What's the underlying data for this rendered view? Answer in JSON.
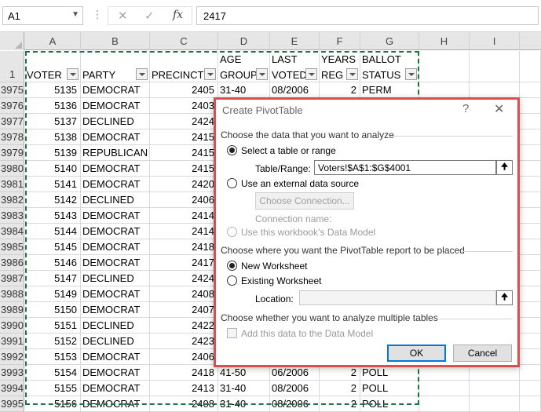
{
  "formula_bar": {
    "name_box": "A1",
    "formula": "2417"
  },
  "columns": [
    "A",
    "B",
    "C",
    "D",
    "E",
    "F",
    "G",
    "H",
    "I"
  ],
  "header_row": {
    "row_number": "1",
    "cells": [
      {
        "l1": "",
        "l2": "VOTER"
      },
      {
        "l1": "",
        "l2": "PARTY"
      },
      {
        "l1": "",
        "l2": "PRECINCT"
      },
      {
        "l1": "AGE",
        "l2": "GROUP"
      },
      {
        "l1": "LAST",
        "l2": "VOTED"
      },
      {
        "l1": "YEARS",
        "l2": "REG"
      },
      {
        "l1": "BALLOT",
        "l2": "STATUS"
      }
    ]
  },
  "rows": [
    {
      "n": "3975",
      "a": "5135",
      "b": "DEMOCRAT",
      "c": "2405",
      "d": "31-40",
      "e": "08/2006",
      "f": "2",
      "g": "PERM"
    },
    {
      "n": "3976",
      "a": "5136",
      "b": "DEMOCRAT",
      "c": "2403",
      "d": "",
      "e": "",
      "f": "",
      "g": ""
    },
    {
      "n": "3977",
      "a": "5137",
      "b": "DECLINED",
      "c": "2424",
      "d": "",
      "e": "",
      "f": "",
      "g": ""
    },
    {
      "n": "3978",
      "a": "5138",
      "b": "DEMOCRAT",
      "c": "2415",
      "d": "",
      "e": "",
      "f": "",
      "g": ""
    },
    {
      "n": "3979",
      "a": "5139",
      "b": "REPUBLICAN",
      "c": "2415",
      "d": "",
      "e": "",
      "f": "",
      "g": ""
    },
    {
      "n": "3980",
      "a": "5140",
      "b": "DEMOCRAT",
      "c": "2415",
      "d": "",
      "e": "",
      "f": "",
      "g": ""
    },
    {
      "n": "3981",
      "a": "5141",
      "b": "DEMOCRAT",
      "c": "2420",
      "d": "",
      "e": "",
      "f": "",
      "g": ""
    },
    {
      "n": "3982",
      "a": "5142",
      "b": "DECLINED",
      "c": "2406",
      "d": "",
      "e": "",
      "f": "",
      "g": ""
    },
    {
      "n": "3983",
      "a": "5143",
      "b": "DEMOCRAT",
      "c": "2414",
      "d": "",
      "e": "",
      "f": "",
      "g": ""
    },
    {
      "n": "3984",
      "a": "5144",
      "b": "DEMOCRAT",
      "c": "2414",
      "d": "",
      "e": "",
      "f": "",
      "g": ""
    },
    {
      "n": "3985",
      "a": "5145",
      "b": "DEMOCRAT",
      "c": "2418",
      "d": "",
      "e": "",
      "f": "",
      "g": ""
    },
    {
      "n": "3986",
      "a": "5146",
      "b": "DEMOCRAT",
      "c": "2417",
      "d": "",
      "e": "",
      "f": "",
      "g": ""
    },
    {
      "n": "3987",
      "a": "5147",
      "b": "DECLINED",
      "c": "2424",
      "d": "",
      "e": "",
      "f": "",
      "g": ""
    },
    {
      "n": "3988",
      "a": "5149",
      "b": "DEMOCRAT",
      "c": "2408",
      "d": "",
      "e": "",
      "f": "",
      "g": ""
    },
    {
      "n": "3989",
      "a": "5150",
      "b": "DEMOCRAT",
      "c": "2407",
      "d": "",
      "e": "",
      "f": "",
      "g": ""
    },
    {
      "n": "3990",
      "a": "5151",
      "b": "DECLINED",
      "c": "2422",
      "d": "",
      "e": "",
      "f": "",
      "g": ""
    },
    {
      "n": "3991",
      "a": "5152",
      "b": "DECLINED",
      "c": "2423",
      "d": "",
      "e": "",
      "f": "",
      "g": ""
    },
    {
      "n": "3992",
      "a": "5153",
      "b": "DEMOCRAT",
      "c": "2406",
      "d": "",
      "e": "",
      "f": "",
      "g": ""
    },
    {
      "n": "3993",
      "a": "5154",
      "b": "DEMOCRAT",
      "c": "2418",
      "d": "41-50",
      "e": "06/2006",
      "f": "2",
      "g": "POLL"
    },
    {
      "n": "3994",
      "a": "5155",
      "b": "DEMOCRAT",
      "c": "2413",
      "d": "31-40",
      "e": "08/2006",
      "f": "2",
      "g": "POLL"
    },
    {
      "n": "3995",
      "a": "5156",
      "b": "DEMOCRAT",
      "c": "2408",
      "d": "31-40",
      "e": "08/2006",
      "f": "2",
      "g": "POLL"
    }
  ],
  "dialog": {
    "title": "Create PivotTable",
    "help": "?",
    "close": "✕",
    "section1": "Choose the data that you want to analyze",
    "opt_table": "Select a table or range",
    "table_range_label": "Table/Range:",
    "table_range_value": "Voters!$A$1:$G$4001",
    "opt_external": "Use an external data source",
    "choose_connection": "Choose Connection...",
    "connection_name_label": "Connection name:",
    "opt_data_model": "Use this workbook’s Data Model",
    "section2": "Choose where you want the PivotTable report to be placed",
    "opt_new_ws": "New Worksheet",
    "opt_existing_ws": "Existing Worksheet",
    "location_label": "Location:",
    "location_value": "",
    "section3": "Choose whether you want to analyze multiple tables",
    "add_to_model": "Add this data to the Data Model",
    "ok": "OK",
    "cancel": "Cancel"
  }
}
